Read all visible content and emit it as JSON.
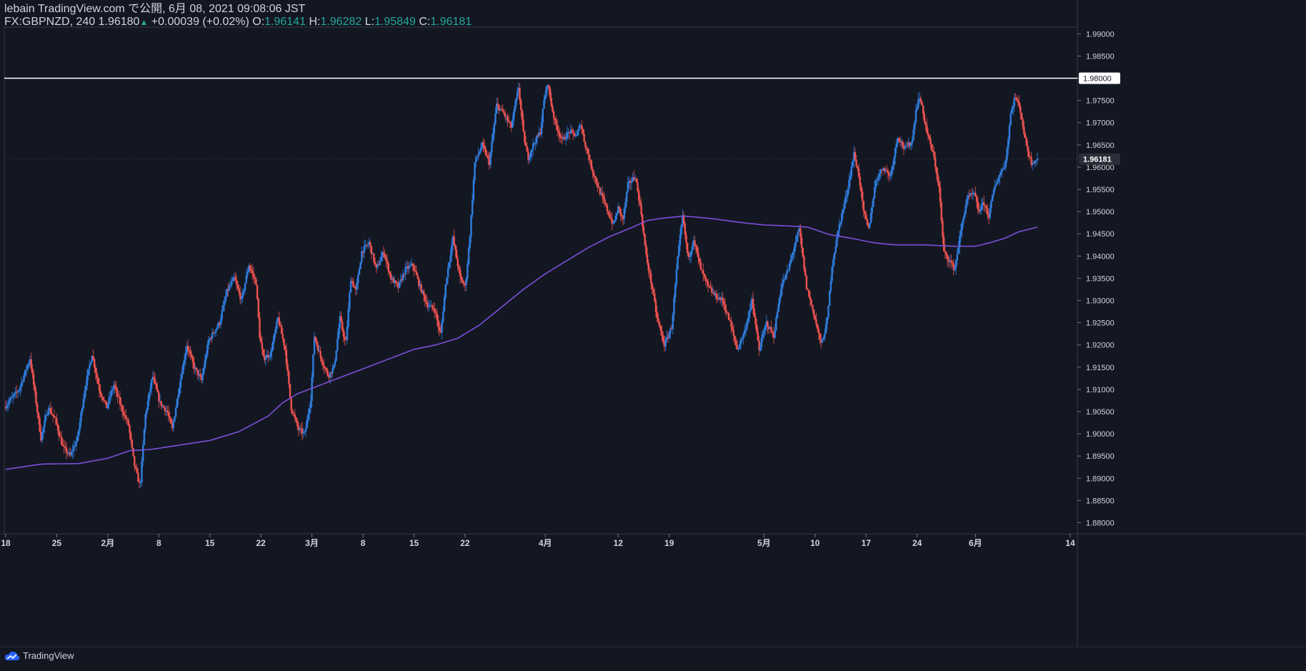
{
  "header": {
    "line1": "lebain TradingView.com で公開, 6月 08, 2021 09:08:06 JST",
    "symbol": "FX:GBPNZD, 240",
    "last": "1.96180",
    "up_arrow": "▲",
    "change": "+0.00039 (+0.02%)",
    "o_label": "O:",
    "o_value": "1.96141",
    "h_label": "H:",
    "h_value": "1.96282",
    "l_label": "L:",
    "l_value": "1.95849",
    "c_label": "C:",
    "c_value": "1.96181"
  },
  "footer": {
    "brand": "TradingView",
    "logo_icon": "tradingview-cloud-icon"
  },
  "colors": {
    "background": "#131722",
    "up": "#2f7ee0",
    "down": "#ef5350",
    "ma": "#7b4fd8",
    "hline": "#ffffff",
    "grid_text": "#d1d4dc",
    "green": "#26a69a"
  },
  "chart_data": {
    "type": "candlestick",
    "symbol": "FX:GBPNZD",
    "interval": "240",
    "ylim": [
      1.8775,
      1.9915
    ],
    "y_ticks": [
      "1.99000",
      "1.98500",
      "1.98000",
      "1.97500",
      "1.97000",
      "1.96500",
      "1.96000",
      "1.95500",
      "1.95000",
      "1.94500",
      "1.94000",
      "1.93500",
      "1.93000",
      "1.92500",
      "1.92000",
      "1.91500",
      "1.91000",
      "1.90500",
      "1.90000",
      "1.89500",
      "1.89000",
      "1.88500",
      "1.88000"
    ],
    "x_ticks": [
      {
        "label": "18",
        "t": 0
      },
      {
        "label": "25",
        "t": 7
      },
      {
        "label": "2月",
        "t": 14
      },
      {
        "label": "8",
        "t": 21
      },
      {
        "label": "15",
        "t": 28
      },
      {
        "label": "22",
        "t": 35
      },
      {
        "label": "3月",
        "t": 42
      },
      {
        "label": "8",
        "t": 49
      },
      {
        "label": "15",
        "t": 56
      },
      {
        "label": "22",
        "t": 63
      },
      {
        "label": "4月",
        "t": 74
      },
      {
        "label": "12",
        "t": 84
      },
      {
        "label": "19",
        "t": 91
      },
      {
        "label": "5月",
        "t": 104
      },
      {
        "label": "10",
        "t": 111
      },
      {
        "label": "17",
        "t": 118
      },
      {
        "label": "24",
        "t": 125
      },
      {
        "label": "6月",
        "t": 133
      },
      {
        "label": "14",
        "t": 146
      }
    ],
    "price_key_points": [
      [
        0,
        1.906
      ],
      [
        2,
        1.91
      ],
      [
        3.5,
        1.917
      ],
      [
        4.5,
        1.905
      ],
      [
        5,
        1.899
      ],
      [
        6,
        1.906
      ],
      [
        7,
        1.903
      ],
      [
        8,
        1.897
      ],
      [
        9,
        1.895
      ],
      [
        10,
        1.899
      ],
      [
        11,
        1.91
      ],
      [
        12,
        1.918
      ],
      [
        13,
        1.91
      ],
      [
        14,
        1.906
      ],
      [
        15,
        1.911
      ],
      [
        16,
        1.906
      ],
      [
        17,
        1.902
      ],
      [
        17.8,
        1.893
      ],
      [
        18.6,
        1.888
      ],
      [
        19.3,
        1.904
      ],
      [
        20.3,
        1.913
      ],
      [
        21.3,
        1.907
      ],
      [
        22.3,
        1.905
      ],
      [
        23,
        1.901
      ],
      [
        24,
        1.911
      ],
      [
        25,
        1.92
      ],
      [
        26,
        1.915
      ],
      [
        27,
        1.912
      ],
      [
        28,
        1.921
      ],
      [
        29.5,
        1.925
      ],
      [
        30.5,
        1.932
      ],
      [
        31.5,
        1.935
      ],
      [
        32.5,
        1.93
      ],
      [
        33.5,
        1.938
      ],
      [
        34.5,
        1.934
      ],
      [
        35,
        1.922
      ],
      [
        35.5,
        1.917
      ],
      [
        36.5,
        1.918
      ],
      [
        37.5,
        1.926
      ],
      [
        38.5,
        1.919
      ],
      [
        39.3,
        1.906
      ],
      [
        40.3,
        1.901
      ],
      [
        41.2,
        1.9
      ],
      [
        42,
        1.908
      ],
      [
        42.5,
        1.922
      ],
      [
        43.4,
        1.917
      ],
      [
        44.4,
        1.913
      ],
      [
        45.2,
        1.915
      ],
      [
        46,
        1.926
      ],
      [
        46.8,
        1.92
      ],
      [
        47.5,
        1.935
      ],
      [
        48.2,
        1.932
      ],
      [
        49,
        1.941
      ],
      [
        50,
        1.943
      ],
      [
        51,
        1.937
      ],
      [
        52,
        1.941
      ],
      [
        53,
        1.935
      ],
      [
        54,
        1.933
      ],
      [
        55,
        1.937
      ],
      [
        56,
        1.938
      ],
      [
        57,
        1.933
      ],
      [
        58,
        1.929
      ],
      [
        59,
        1.928
      ],
      [
        59.8,
        1.922
      ],
      [
        60.6,
        1.935
      ],
      [
        61.5,
        1.944
      ],
      [
        62.5,
        1.935
      ],
      [
        63.2,
        1.933
      ],
      [
        63.8,
        1.944
      ],
      [
        64.5,
        1.961
      ],
      [
        65.5,
        1.965
      ],
      [
        66.5,
        1.961
      ],
      [
        67.5,
        1.974
      ],
      [
        68.5,
        1.972
      ],
      [
        69.5,
        1.969
      ],
      [
        70.5,
        1.978
      ],
      [
        71.2,
        1.967
      ],
      [
        71.8,
        1.962
      ],
      [
        72.5,
        1.965
      ],
      [
        73.5,
        1.968
      ],
      [
        74,
        1.975
      ],
      [
        74.5,
        1.979
      ],
      [
        75,
        1.974
      ],
      [
        75.5,
        1.97
      ],
      [
        76.5,
        1.966
      ],
      [
        77.5,
        1.968
      ],
      [
        78.5,
        1.967
      ],
      [
        79,
        1.97
      ],
      [
        79.5,
        1.966
      ],
      [
        80.5,
        1.96
      ],
      [
        81.5,
        1.955
      ],
      [
        82.5,
        1.951
      ],
      [
        83.5,
        1.947
      ],
      [
        84.2,
        1.951
      ],
      [
        84.8,
        1.948
      ],
      [
        85.5,
        1.956
      ],
      [
        86.5,
        1.958
      ],
      [
        87.3,
        1.95
      ],
      [
        88,
        1.94
      ],
      [
        88.8,
        1.933
      ],
      [
        89.5,
        1.926
      ],
      [
        90.5,
        1.92
      ],
      [
        91.5,
        1.924
      ],
      [
        92.3,
        1.939
      ],
      [
        93,
        1.949
      ],
      [
        93.8,
        1.939
      ],
      [
        94.5,
        1.944
      ],
      [
        95.5,
        1.937
      ],
      [
        96.5,
        1.933
      ],
      [
        97.5,
        1.931
      ],
      [
        98.5,
        1.93
      ],
      [
        99.5,
        1.925
      ],
      [
        100.5,
        1.919
      ],
      [
        101.5,
        1.923
      ],
      [
        102.5,
        1.93
      ],
      [
        103.5,
        1.919
      ],
      [
        104.5,
        1.925
      ],
      [
        105.5,
        1.922
      ],
      [
        106.5,
        1.933
      ],
      [
        107.5,
        1.937
      ],
      [
        108.3,
        1.942
      ],
      [
        109,
        1.946
      ],
      [
        110,
        1.933
      ],
      [
        111,
        1.927
      ],
      [
        112,
        1.92
      ],
      [
        112.8,
        1.925
      ],
      [
        113.5,
        1.938
      ],
      [
        114.5,
        1.947
      ],
      [
        115.5,
        1.954
      ],
      [
        116.5,
        1.963
      ],
      [
        117.2,
        1.958
      ],
      [
        117.8,
        1.95
      ],
      [
        118.5,
        1.946
      ],
      [
        119.5,
        1.957
      ],
      [
        120.5,
        1.96
      ],
      [
        121.5,
        1.958
      ],
      [
        122.5,
        1.967
      ],
      [
        123.5,
        1.964
      ],
      [
        124.5,
        1.966
      ],
      [
        125,
        1.973
      ],
      [
        125.5,
        1.976
      ],
      [
        126.5,
        1.968
      ],
      [
        127.5,
        1.962
      ],
      [
        128.2,
        1.955
      ],
      [
        128.8,
        1.941
      ],
      [
        129.6,
        1.939
      ],
      [
        130.3,
        1.937
      ],
      [
        131.1,
        1.945
      ],
      [
        132,
        1.953
      ],
      [
        133,
        1.954
      ],
      [
        133.6,
        1.95
      ],
      [
        134.3,
        1.952
      ],
      [
        135,
        1.949
      ],
      [
        135.7,
        1.955
      ],
      [
        136.4,
        1.958
      ],
      [
        137.3,
        1.961
      ],
      [
        138,
        1.972
      ],
      [
        138.6,
        1.976
      ],
      [
        139.3,
        1.973
      ],
      [
        140,
        1.966
      ],
      [
        140.8,
        1.961
      ],
      [
        141.5,
        1.9618
      ]
    ],
    "ma_key_points": [
      [
        0,
        1.892
      ],
      [
        5,
        1.8932
      ],
      [
        10,
        1.8933
      ],
      [
        14,
        1.8945
      ],
      [
        17,
        1.8962
      ],
      [
        20,
        1.8965
      ],
      [
        24,
        1.8975
      ],
      [
        28,
        1.8985
      ],
      [
        32,
        1.9005
      ],
      [
        36,
        1.904
      ],
      [
        38,
        1.907
      ],
      [
        40,
        1.909
      ],
      [
        44,
        1.9115
      ],
      [
        48,
        1.914
      ],
      [
        52,
        1.9165
      ],
      [
        56,
        1.919
      ],
      [
        59,
        1.92
      ],
      [
        62,
        1.9215
      ],
      [
        65,
        1.9245
      ],
      [
        68,
        1.9285
      ],
      [
        71,
        1.9325
      ],
      [
        74,
        1.936
      ],
      [
        77,
        1.939
      ],
      [
        80,
        1.942
      ],
      [
        83,
        1.9445
      ],
      [
        86,
        1.9465
      ],
      [
        88,
        1.948
      ],
      [
        90,
        1.9485
      ],
      [
        93,
        1.949
      ],
      [
        97,
        1.9484
      ],
      [
        101,
        1.9475
      ],
      [
        104,
        1.947
      ],
      [
        107,
        1.9468
      ],
      [
        110,
        1.9465
      ],
      [
        113,
        1.9448
      ],
      [
        116,
        1.944
      ],
      [
        119,
        1.943
      ],
      [
        122,
        1.9425
      ],
      [
        126,
        1.9425
      ],
      [
        130,
        1.9422
      ],
      [
        133,
        1.9422
      ],
      [
        135,
        1.943
      ],
      [
        137,
        1.944
      ],
      [
        139,
        1.9455
      ],
      [
        141.5,
        1.9465
      ]
    ],
    "horizontal_line": {
      "price": 1.98,
      "label": "1.98000"
    },
    "last_price": {
      "price": 1.96181,
      "label": "1.96181"
    }
  }
}
